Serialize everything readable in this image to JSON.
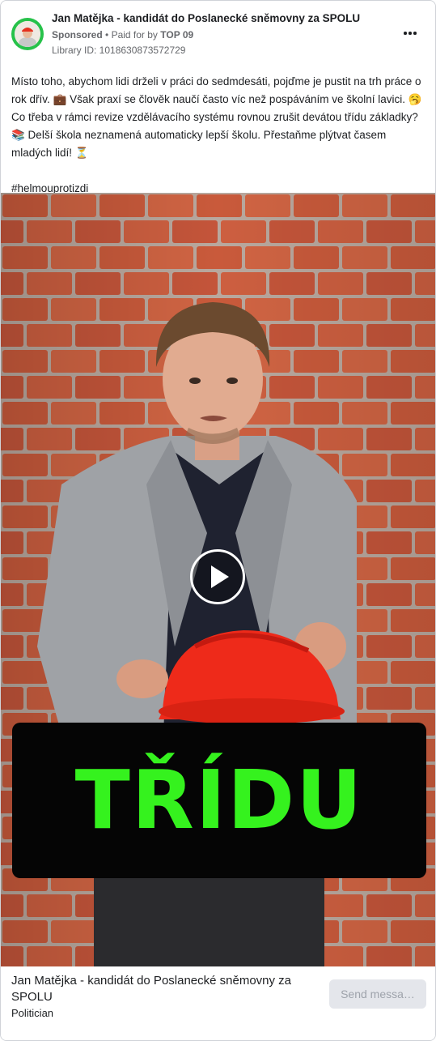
{
  "advertiser": {
    "name": "Jan Matějka - kandidát do Poslanecké sněmovny za SPOLU",
    "sponsored_label": "Sponsored",
    "paid_for_by_label": "Paid for by",
    "funder": "TOP 09",
    "library_id": "Library ID: 1018630873572729"
  },
  "post": {
    "body_line1": "Místo toho, abychom lidi drželi v práci do sedmdesáti, pojďme je pustit na trh práce o rok dřív. 💼 Však praxí se člověk naučí často víc než pospáváním ve školní lavici. 🥱 Co třeba v rámci revize vzdělávacího systému rovnou zrušit devátou třídu základky? 📚 Delší škola neznamená automaticky lepší školu. Přestaňme plýtvat časem mladých lidí! ⏳",
    "hashtag": "#helmouprotizdi"
  },
  "video": {
    "caption": "TŘÍDU",
    "caption_color": "#35f21e"
  },
  "footer": {
    "title": "Jan Matějka - kandidát do Poslanecké sněmovny za SPOLU",
    "category": "Politician",
    "cta_label": "Send messa…"
  },
  "icons": {
    "more": "more-options-icon",
    "play": "play-icon"
  },
  "colors": {
    "avatar_ring": "#27c24a",
    "helmet": "#ee2a1a",
    "bricks": "#c95a3b"
  }
}
